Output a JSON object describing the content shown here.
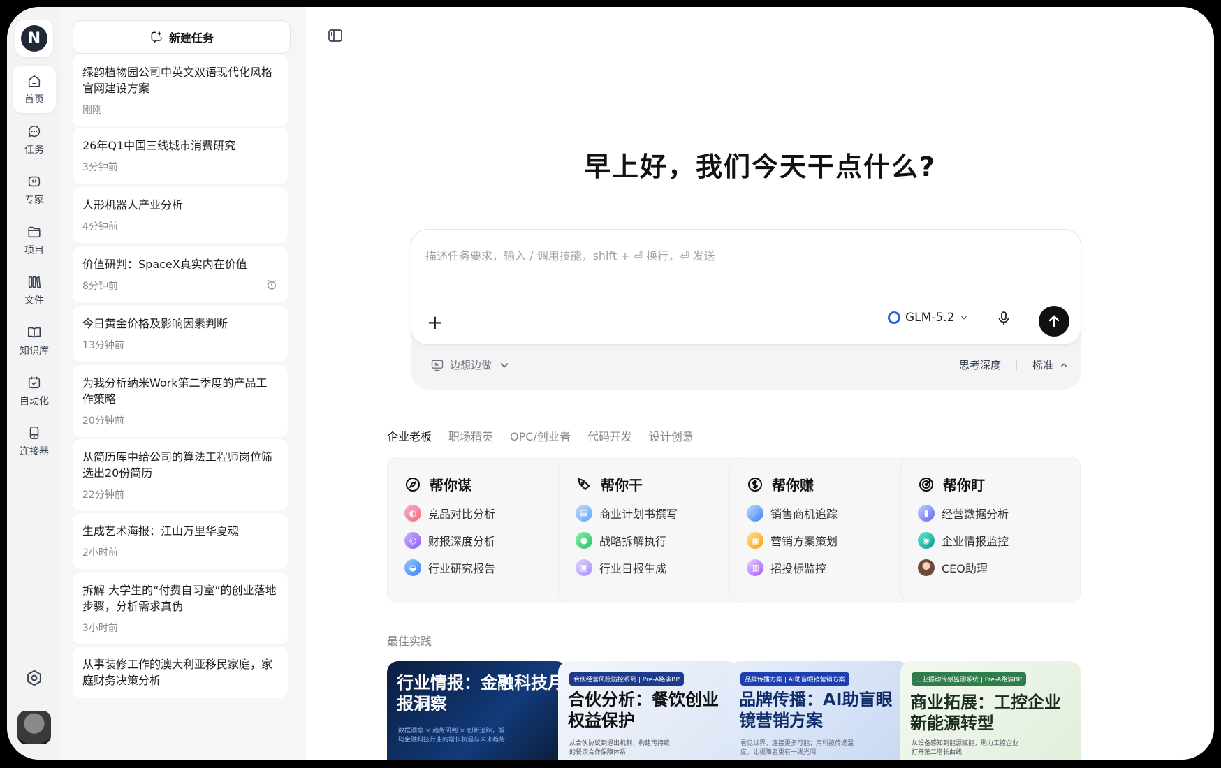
{
  "sidebar": {
    "logo": "N",
    "nav": [
      {
        "label": "首页",
        "icon": "home-icon"
      },
      {
        "label": "任务",
        "icon": "chat-icon"
      },
      {
        "label": "专家",
        "icon": "expert-icon"
      },
      {
        "label": "项目",
        "icon": "folder-icon"
      },
      {
        "label": "文件",
        "icon": "library-icon"
      },
      {
        "label": "知识库",
        "icon": "book-icon"
      },
      {
        "label": "自动化",
        "icon": "calendar-check-icon"
      },
      {
        "label": "连接器",
        "icon": "connector-icon"
      }
    ]
  },
  "tasks": {
    "new_task_label": "新建任务",
    "items": [
      {
        "title": "绿韵植物园公司中英文双语现代化风格官网建设方案",
        "time": "刚刚"
      },
      {
        "title": "26年Q1中国三线城市消费研究",
        "time": "3分钟前"
      },
      {
        "title": "人形机器人产业分析",
        "time": "4分钟前"
      },
      {
        "title": "价值研判：SpaceX真实内在价值",
        "time": "8分钟前",
        "alarm": true
      },
      {
        "title": "今日黄金价格及影响因素判断",
        "time": "13分钟前"
      },
      {
        "title": "为我分析纳米Work第二季度的产品工作策略",
        "time": "20分钟前"
      },
      {
        "title": "从简历库中给公司的算法工程师岗位筛选出20份简历",
        "time": "22分钟前"
      },
      {
        "title": "生成艺术海报：江山万里华夏魂",
        "time": "2小时前"
      },
      {
        "title": "拆解 大学生的“付费自习室”的创业落地步骤，分析需求真伪",
        "time": "3小时前"
      },
      {
        "title": "从事装修工作的澳大利亚移民家庭，家庭财务决策分析",
        "time": ""
      }
    ]
  },
  "main": {
    "greeting": "早上好，我们今天干点什么?",
    "composer": {
      "placeholder": "描述任务要求，输入 / 调用技能，shift + ⏎ 换行，⏎ 发送",
      "model": "GLM-5.2",
      "mode": "边想边做",
      "depth_label": "思考深度",
      "depth_value": "标准"
    },
    "tabs": [
      "企业老板",
      "职场精英",
      "OPC/创业者",
      "代码开发",
      "设计创意"
    ],
    "features": [
      {
        "title": "帮你谋",
        "icon": "compass-icon",
        "items": [
          "竞品对比分析",
          "财报深度分析",
          "行业研究报告"
        ]
      },
      {
        "title": "帮你干",
        "icon": "pen-icon",
        "items": [
          "商业计划书撰写",
          "战略拆解执行",
          "行业日报生成"
        ]
      },
      {
        "title": "帮你赚",
        "icon": "dollar-icon",
        "items": [
          "销售商机追踪",
          "营销方案策划",
          "招投标监控"
        ]
      },
      {
        "title": "帮你盯",
        "icon": "target-icon",
        "items": [
          "经营数据分析",
          "企业情报监控",
          "CEO助理"
        ]
      }
    ],
    "best_practice_label": "最佳实践",
    "best_practices": [
      {
        "title": "行业情报：金融科技月报洞察",
        "tag": "",
        "desc": "数据洞察 × 趋势研判 × 创新追踪，解码金融科技行业的增长机遇与未来趋势"
      },
      {
        "title": "合伙分析：餐饮创业权益保护",
        "tag": "合伙经营风险防控系列 | Pre-A路演BP",
        "desc": "从合伙协议到退出机制，构建可持续的餐饮合作保障体系"
      },
      {
        "title": "品牌传播：AI助盲眼镜营销方案",
        "tag": "品牌传播方案 | AI助盲眼镜营销方案",
        "desc": "看见世界，连接更多可能；用科技传递温度，让视障者更有一线光明"
      },
      {
        "title": "商业拓展：工控企业新能源转型",
        "tag": "工业振动传感监测系统 | Pre-A路演BP",
        "desc": "从设备感知到能源赋能，助力工控企业打开第二增长曲线"
      }
    ]
  }
}
